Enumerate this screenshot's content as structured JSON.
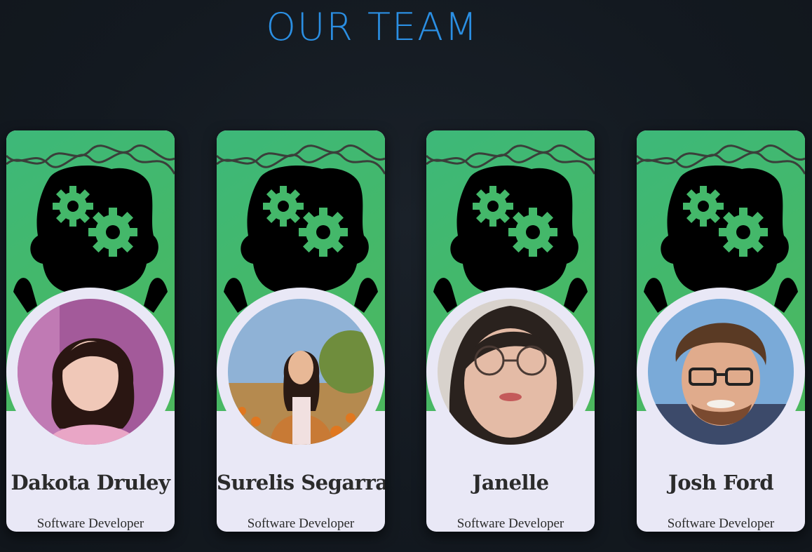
{
  "page": {
    "title": "OUR TEAM"
  },
  "colors": {
    "background": "#141b23",
    "title": "#2b8fe3",
    "card": "#e9e8f6",
    "banner_green": "#44b86a",
    "text": "#2b2b2b"
  },
  "team": [
    {
      "name": "Dakota Druley",
      "role": "Software Developer",
      "banner_icon": "brain-gears-icon",
      "photo": "avatar-photo"
    },
    {
      "name": "Surelis Segarra",
      "role": "Software Developer",
      "banner_icon": "brain-gears-icon",
      "photo": "avatar-photo"
    },
    {
      "name": "Janelle",
      "role": "Software Developer",
      "banner_icon": "brain-gears-icon",
      "photo": "avatar-photo"
    },
    {
      "name": "Josh Ford",
      "role": "Software Developer",
      "banner_icon": "brain-gears-icon",
      "photo": "avatar-photo"
    }
  ]
}
